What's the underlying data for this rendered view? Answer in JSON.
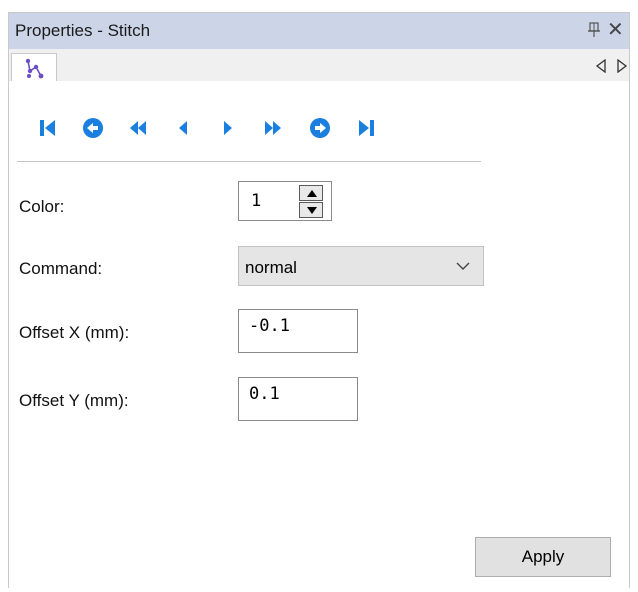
{
  "panel": {
    "title": "Properties - Stitch",
    "pin_icon": "pin-icon",
    "close_label": "✕"
  },
  "tabs": [
    {
      "icon": "stitch-icon",
      "active": true
    }
  ],
  "tab_scroll": {
    "left_icon": "triangle-left-outline-icon",
    "right_icon": "triangle-right-outline-icon"
  },
  "navigation": {
    "buttons": [
      "first-stitch-icon",
      "previous-circle-icon",
      "fast-back-icon",
      "step-back-icon",
      "step-forward-icon",
      "fast-forward-icon",
      "next-circle-icon",
      "last-stitch-icon"
    ],
    "color": "#1b7fe0"
  },
  "form": {
    "color_label": "Color:",
    "color_value": "1",
    "command_label": "Command:",
    "command_value": "normal",
    "offset_x_label": "Offset X (mm):",
    "offset_x_value": "-0.1",
    "offset_y_label": "Offset Y (mm):",
    "offset_y_value": "0.1"
  },
  "actions": {
    "apply_label": "Apply"
  }
}
